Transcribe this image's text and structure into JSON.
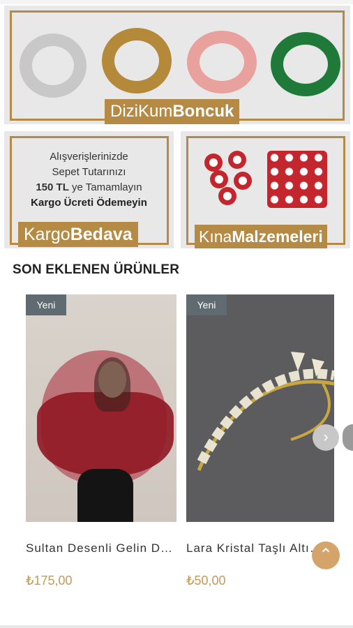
{
  "banner_main": {
    "tag_light": "DiziKum",
    "tag_bold": "Boncuk",
    "necklace_colors": [
      "#c8c8c8",
      "#b48a3a",
      "#e8a19c",
      "#1f7a3a"
    ]
  },
  "promo_left": {
    "line1": "Alışverişlerinizde",
    "line2": "Sepet Tutarınızı",
    "line3_bold": "150 TL",
    "line3_rest": " ye Tamamlayın",
    "line4": "Kargo Ücreti Ödemeyin",
    "tag_light": "Kargo",
    "tag_bold": "Bedava"
  },
  "promo_right": {
    "tag_light": "Kına",
    "tag_bold": "Malzemeleri"
  },
  "section": {
    "title": "SON EKLENEN ÜRÜNLER"
  },
  "products": [
    {
      "badge": "Yeni",
      "name": "Sultan Desenli Gelin Duvağı",
      "price": "₺175,00"
    },
    {
      "badge": "Yeni",
      "name": "Lara Kristal Taşlı Altın Taç",
      "price": "₺50,00"
    }
  ],
  "icons": {
    "next": "chevron-right-icon",
    "back_to_top": "chevron-up-icon"
  },
  "colors": {
    "accent": "#b58a45",
    "price": "#c79a54",
    "badge": "#5f6b70"
  }
}
